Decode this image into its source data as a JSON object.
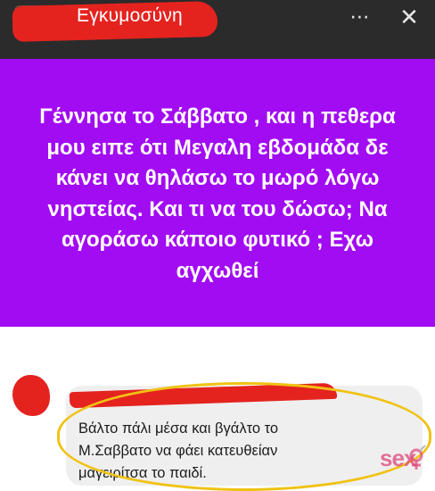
{
  "header": {
    "group_name": "Εγκυμοσύνη",
    "more_icon": "⋯",
    "close_icon": "✕"
  },
  "post": {
    "background_color": "#a20cf2",
    "text": "Γέννησα το Σάββατο , και η πεθερα μου ειπε ότι Μεγαλη εβδομάδα δε κάνει να θηλάσω το μωρό λόγω νηστείας. Και τι να του δώσω; Να αγοράσω κάποιο φυτικό ; Εχω αγχωθεί"
  },
  "comment": {
    "text_line1": "Βάλτο πάλι μέσα και βγάλτο το",
    "text_line2": "Μ.Σαββατο να φάει κατευθείαν",
    "text_line3": "μαγειρίτσα το παιδί."
  },
  "watermark": {
    "text": "sex",
    "icon": "venus-mars-icon"
  }
}
